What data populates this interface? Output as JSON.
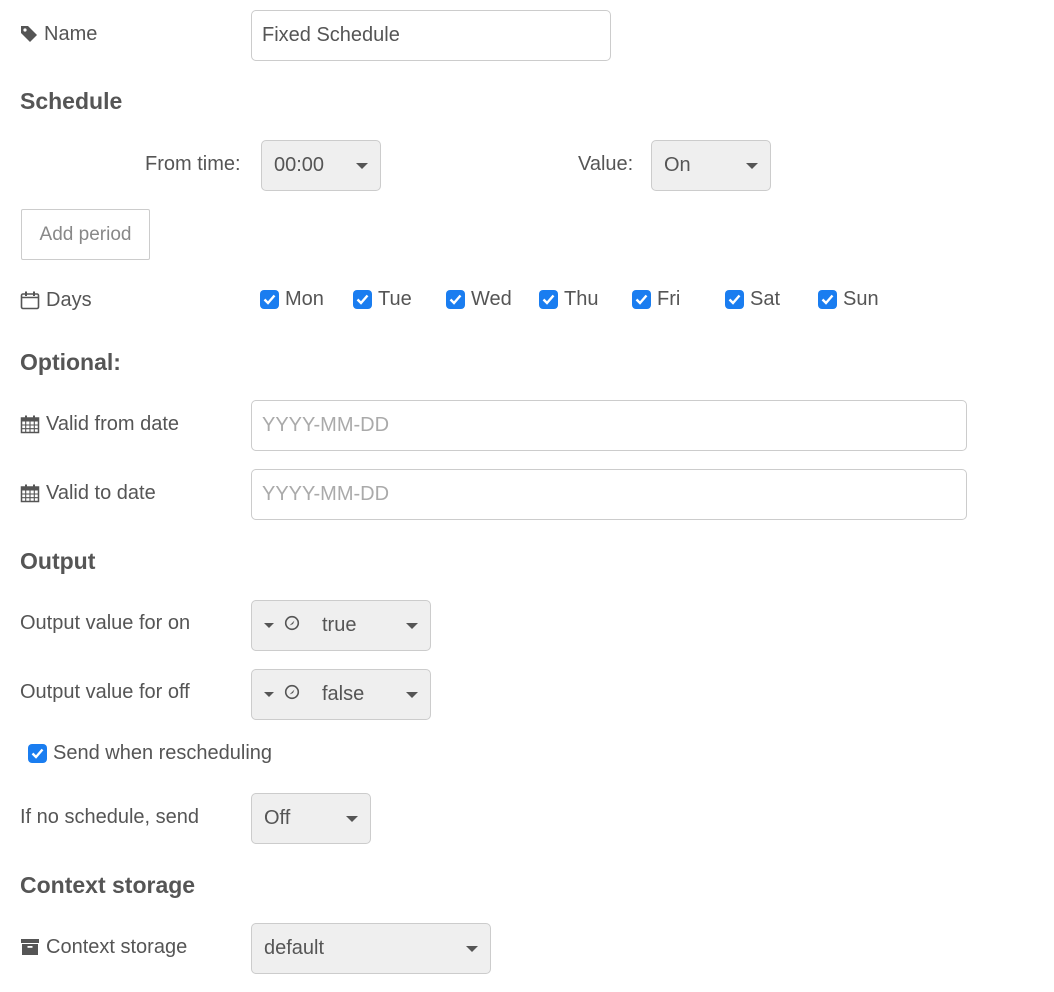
{
  "name": {
    "label": "Name",
    "icon": "tag-icon",
    "value": "Fixed Schedule"
  },
  "schedule": {
    "heading": "Schedule",
    "from_time_label": "From time:",
    "from_time_value": "00:00",
    "value_label": "Value:",
    "value_value": "On",
    "add_period_label": "Add period"
  },
  "days": {
    "label": "Days",
    "icon": "calendar-outline-icon",
    "items": [
      {
        "label": "Mon",
        "checked": true
      },
      {
        "label": "Tue",
        "checked": true
      },
      {
        "label": "Wed",
        "checked": true
      },
      {
        "label": "Thu",
        "checked": true
      },
      {
        "label": "Fri",
        "checked": true
      },
      {
        "label": "Sat",
        "checked": true
      },
      {
        "label": "Sun",
        "checked": true
      }
    ]
  },
  "optional": {
    "heading": "Optional:",
    "valid_from_label": "Valid from date",
    "valid_from_placeholder": "YYYY-MM-DD",
    "valid_from_value": "",
    "valid_to_label": "Valid to date",
    "valid_to_placeholder": "YYYY-MM-DD",
    "valid_to_value": "",
    "icon": "calendar-icon"
  },
  "output": {
    "heading": "Output",
    "on_label": "Output value for on",
    "on_value": "true",
    "off_label": "Output value for off",
    "off_value": "false",
    "type_icon": "boolean-type-icon",
    "send_rescheduling_label": "Send when rescheduling",
    "send_rescheduling_checked": true,
    "no_schedule_label": "If no schedule, send",
    "no_schedule_value": "Off"
  },
  "context": {
    "heading": "Context storage",
    "label": "Context storage",
    "icon": "archive-icon",
    "value": "default"
  },
  "colors": {
    "checkbox": "#1a7df0",
    "text": "#555555",
    "select_bg": "#efefef",
    "border": "#cccccc",
    "placeholder": "#aaaaaa"
  }
}
